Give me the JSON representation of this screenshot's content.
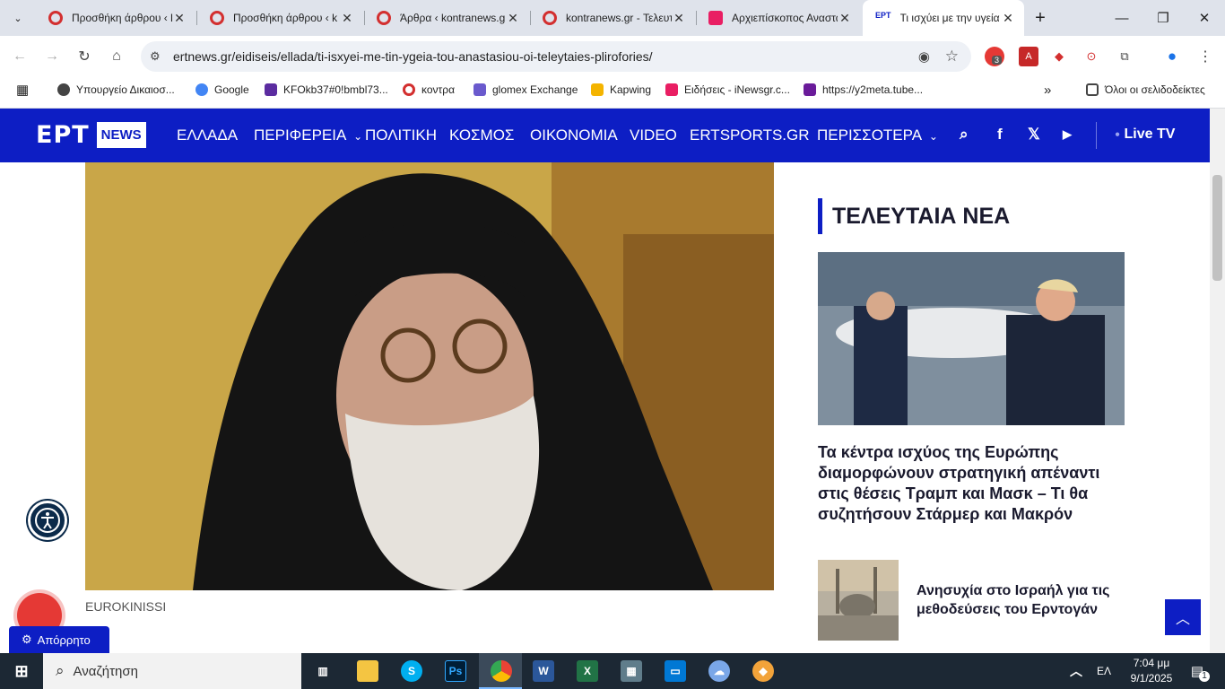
{
  "browser": {
    "tabs": [
      {
        "title": "Προσθήκη άρθρου ‹ k",
        "icon": "kontranews-icon"
      },
      {
        "title": "Προσθήκη άρθρου ‹ k",
        "icon": "kontranews-icon"
      },
      {
        "title": "Άρθρα ‹ kontranews.gr",
        "icon": "kontranews-icon"
      },
      {
        "title": "kontranews.gr - Τελευταία",
        "icon": "kontranews-icon"
      },
      {
        "title": "Αρχιεπίσκοπος Αναστάσιος",
        "icon": "inewsgr-icon"
      },
      {
        "title": "Τι ισχύει με την υγεία",
        "icon": "ert-icon",
        "active": true
      }
    ],
    "new_tab_symbol": "+",
    "window_controls": {
      "minimize": "—",
      "restore": "❐",
      "close": "✕"
    },
    "url": "ertnews.gr/eidiseis/ellada/ti-isxyei-me-tin-ygeia-tou-anastasiou-oi-teleytaies-plirofories/",
    "extension_badge": "3",
    "bookmarks": [
      {
        "label": "Υπουργείο Δικαιοσ...",
        "icon": "globe-icon",
        "color": "#444444"
      },
      {
        "label": "Google",
        "icon": "google-icon",
        "color": "#4285f4"
      },
      {
        "label": "KFOkb37#0!bmbl73...",
        "icon": "purple-box-icon",
        "color": "#5b2ca0"
      },
      {
        "label": "κοντρα",
        "icon": "kontranews-icon",
        "color": "#d32f2f"
      },
      {
        "label": "glomex Exchange",
        "icon": "glomex-icon",
        "color": "#6a5acd"
      },
      {
        "label": "Kapwing",
        "icon": "kapwing-icon",
        "color": "#f4b400"
      },
      {
        "label": "Ειδήσεις - iNewsgr.c...",
        "icon": "inewsgr-icon",
        "color": "#e91e63"
      },
      {
        "label": "https://y2meta.tube...",
        "icon": "y2meta-icon",
        "color": "#6a1b9a"
      }
    ],
    "bookmarks_more": "»",
    "all_bookmarks": "Όλοι οι σελιδοδείκτες"
  },
  "site": {
    "logo_text": "ΕΡΤ",
    "logo_badge": "NEWS",
    "menu": [
      {
        "label": "ΕΛΛΑΔΑ"
      },
      {
        "label": "ΠΕΡΙΦΕΡΕΙΑ",
        "dropdown": true
      },
      {
        "label": "ΠΟΛΙΤΙΚΗ"
      },
      {
        "label": "ΚΟΣΜΟΣ"
      },
      {
        "label": "ΟΙΚΟΝΟΜΙΑ"
      },
      {
        "label": "VIDEO"
      },
      {
        "label": "ERTSPORTS.GR"
      },
      {
        "label": "ΠΕΡΙΣΣΟΤΕΡΑ",
        "dropdown": true
      }
    ],
    "live_label": "Live TV",
    "social": {
      "facebook": "f",
      "x": "𝕏",
      "youtube": "▶"
    },
    "image_caption": "EUROKINISSI",
    "latest_heading": "ΤΕΛΕΥΤΑΙΑ ΝΕΑ",
    "latest": [
      {
        "title": "Τα κέντρα ισχύος της Ευρώπης διαμορφώνουν στρατηγική απέναντι στις θέσεις Τραμπ και Μασκ – Τι θα συζητήσουν Στάρμερ και Μακρόν"
      },
      {
        "title": "Ανησυχία στο Ισραήλ για τις μεθοδεύσεις του Ερντογάν"
      }
    ],
    "privacy_label": "Απόρρητο",
    "brand_color": "#0d1ec4"
  },
  "taskbar": {
    "search_placeholder": "Αναζήτηση",
    "language": "ΕΛ",
    "time": "7:04 μμ",
    "date": "9/1/2025",
    "notification_count": "1"
  }
}
